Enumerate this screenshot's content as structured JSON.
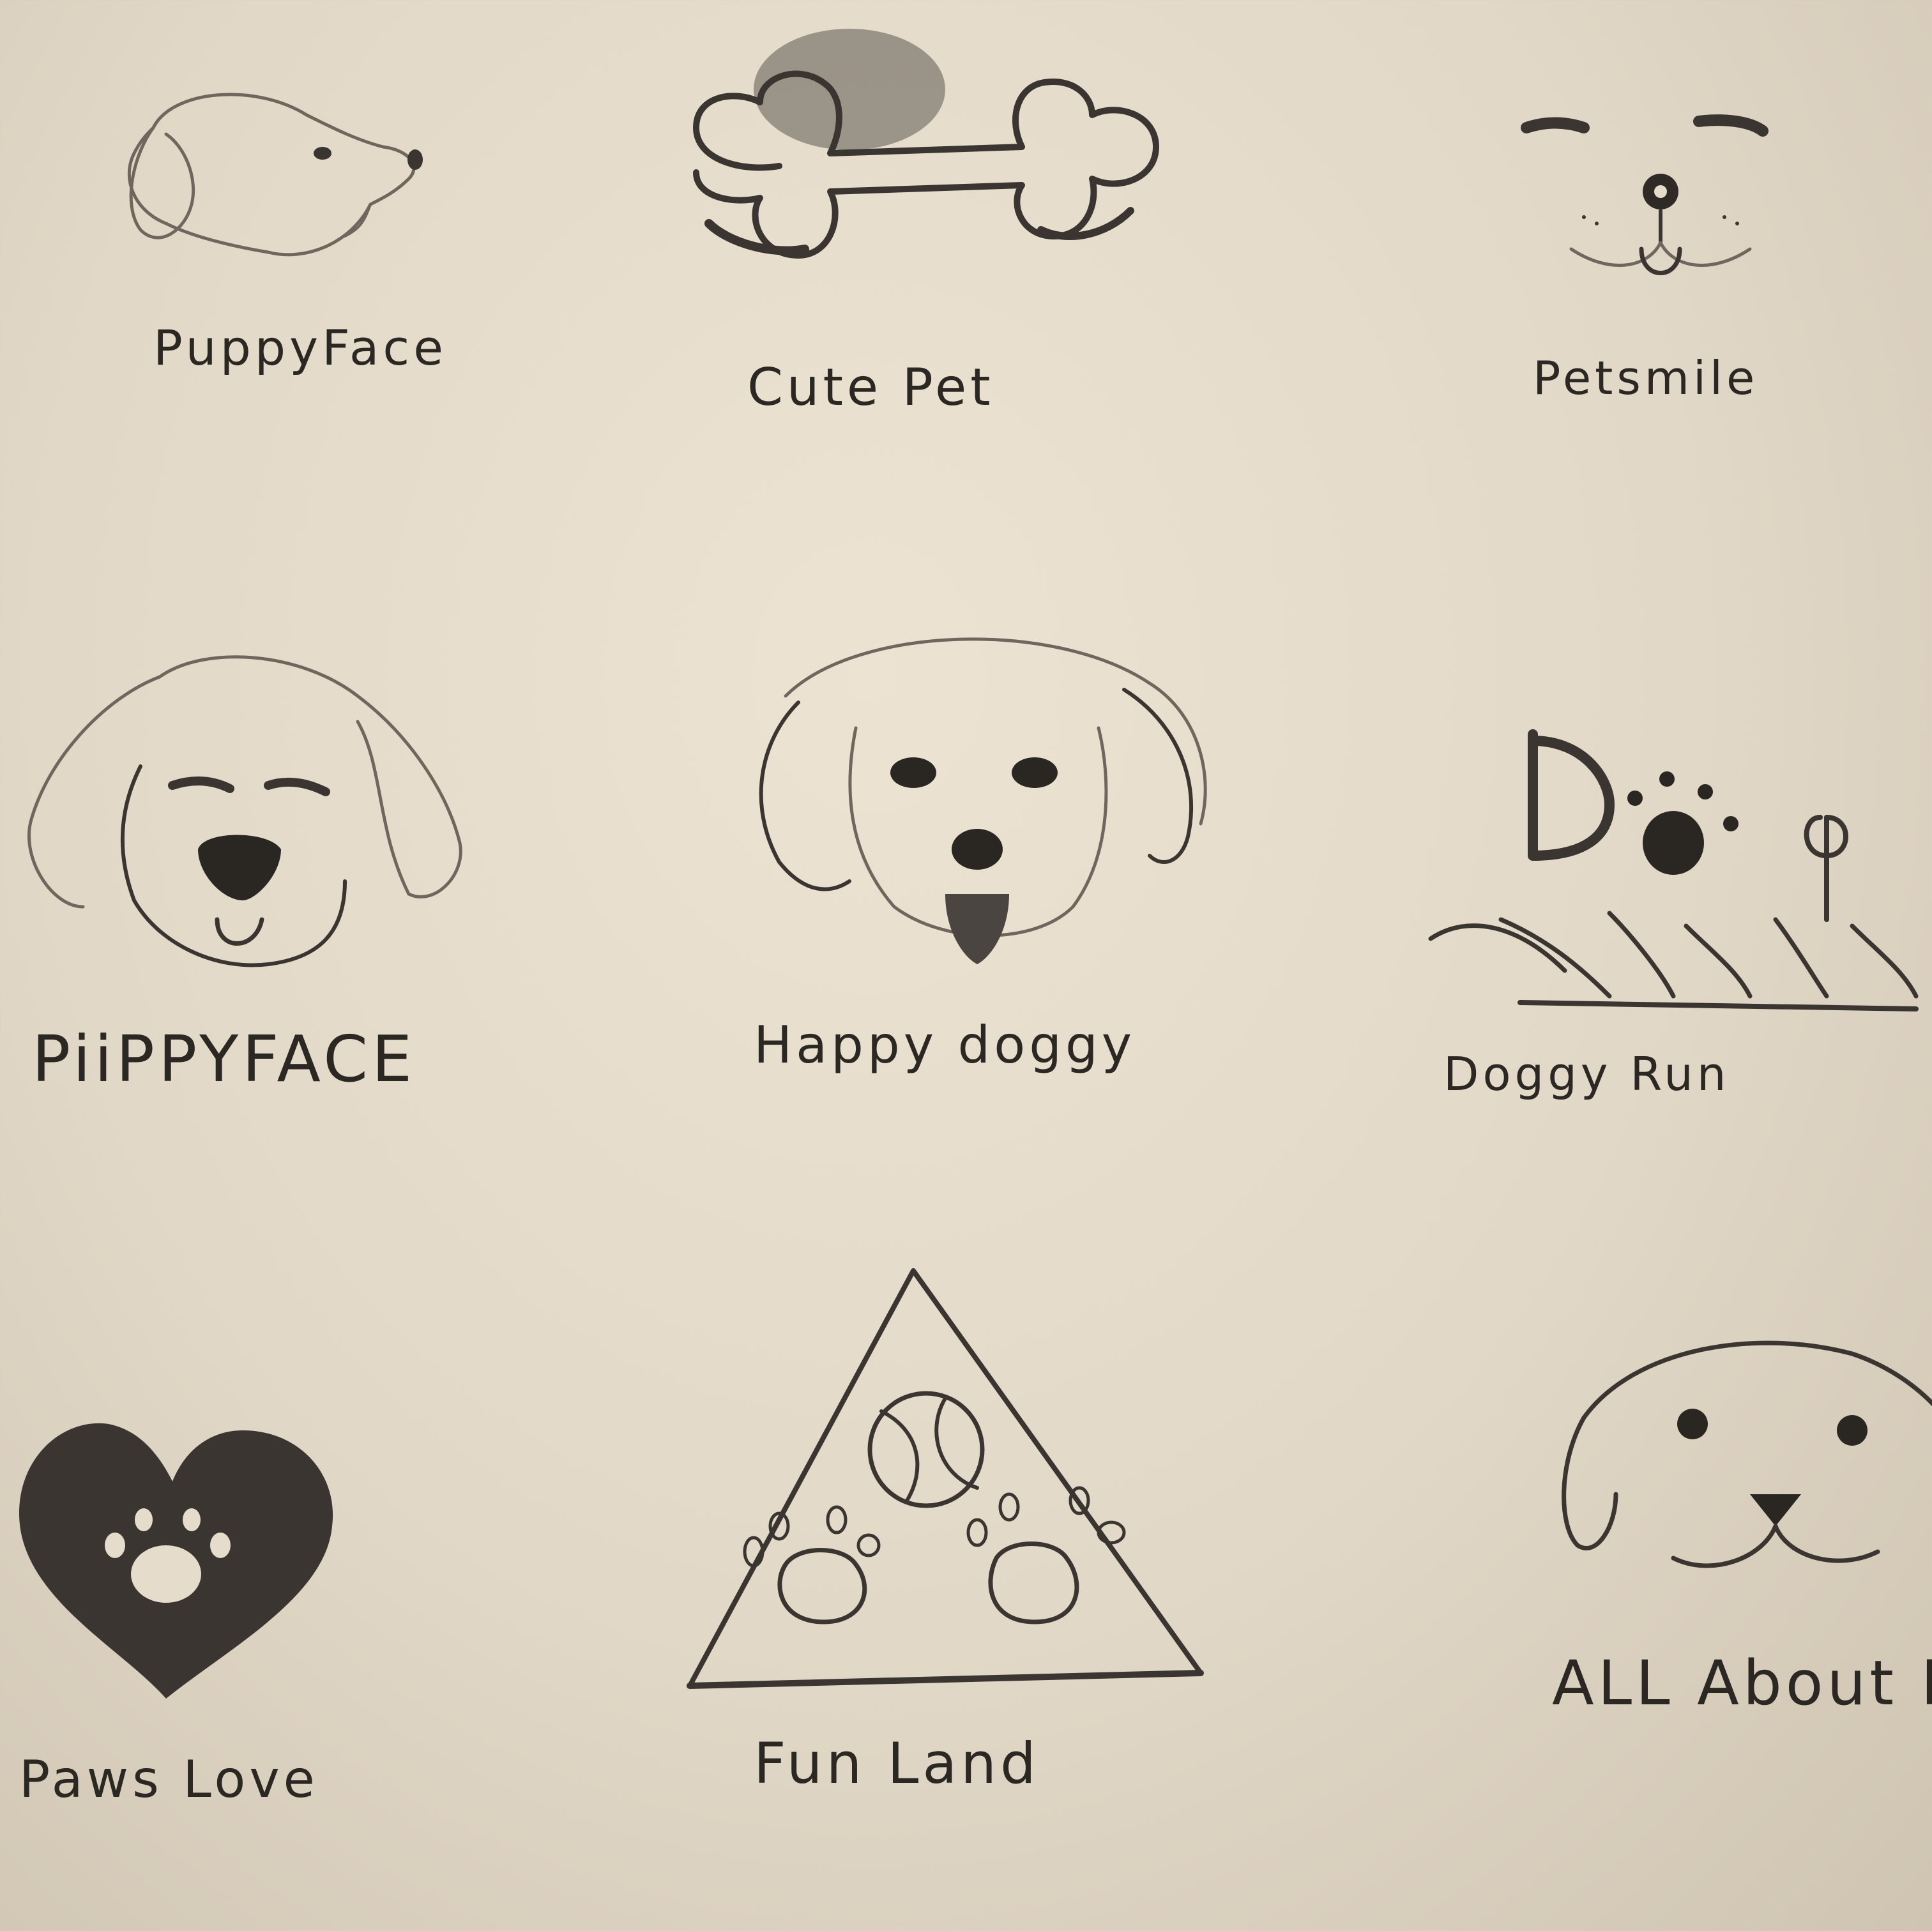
{
  "sketches": [
    {
      "id": "puppy-face-side",
      "label": "PuppyFace",
      "icon": "dog-profile-icon"
    },
    {
      "id": "cute-pet",
      "label": "Cute Pet",
      "icon": "bone-icon"
    },
    {
      "id": "petsmile",
      "label": "Petsmile",
      "icon": "smiling-dog-face-icon"
    },
    {
      "id": "puppy-face-front",
      "label": "PiiPPYFACE",
      "icon": "fluffy-dog-head-icon"
    },
    {
      "id": "happy-doggy",
      "label": "Happy doggy",
      "icon": "dog-head-tongue-icon"
    },
    {
      "id": "doggy-run",
      "label": "Doggy Run",
      "icon": "dog-letters-paw-grass-icon"
    },
    {
      "id": "paws-love",
      "label": "Paws Love",
      "icon": "heart-paw-icon"
    },
    {
      "id": "fun-land",
      "label": "Fun Land",
      "icon": "triangle-ball-paws-icon"
    },
    {
      "id": "all-about-pets",
      "label": "ALL About Pe",
      "icon": "simple-dog-face-icon"
    }
  ],
  "colors": {
    "paper": "#e6dccb",
    "graphite": "#3a3530",
    "graphite_light": "#6f675e"
  }
}
